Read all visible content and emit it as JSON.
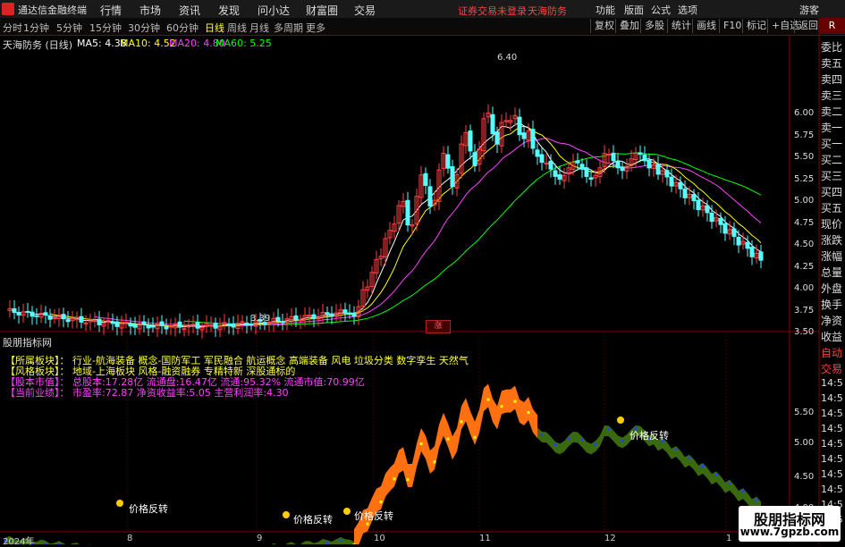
{
  "app": {
    "title": "通达信金融终端",
    "warning": "证券交易未登录",
    "stock_name": "天海防务"
  },
  "menu": [
    "行情",
    "市场",
    "资讯",
    "发现",
    "问小达",
    "财富圈",
    "交易"
  ],
  "right_menu": [
    "功能",
    "版面",
    "公式",
    "选项",
    "游客"
  ],
  "periods": [
    "分时",
    "1分钟",
    "5分钟",
    "15分钟",
    "30分钟",
    "60分钟",
    "日线",
    "周线",
    "月线",
    "多周期",
    "更多"
  ],
  "active_period": "日线",
  "tools": [
    "复权",
    "叠加",
    "多股",
    "统计",
    "画线",
    "F10",
    "标记",
    "+自选",
    "返回"
  ],
  "chart_title": "天海防务 (日线)",
  "ma": {
    "ma5": "MA5: 4.38",
    "ma10": "MA10: 4.52",
    "ma20": "MA20: 4.80",
    "ma60": "MA60: 5.25"
  },
  "colors": {
    "ma5": "#ffffff",
    "ma10": "#ffff00",
    "ma20": "#ff40ff",
    "ma60": "#00ff00",
    "up": "#ff4040",
    "down": "#54ffff"
  },
  "price_axis": [
    "6.00",
    "5.75",
    "5.50",
    "5.25",
    "5.00",
    "4.75",
    "4.50",
    "4.25",
    "4.00",
    "3.75",
    "3.50"
  ],
  "high_label": "6.40",
  "low_label": "3.39",
  "event_tag": "涨",
  "indicator_name": "股朋指标网",
  "indicator_axis": [
    "5.50",
    "5.00",
    "4.50",
    "4.00"
  ],
  "signal_label": "价格反转",
  "info_lines": [
    "【所属板块】：  行业-航海装备 概念-国防军工 军民融合 航运概念 高端装备 风电 垃圾分类 数字孪生 天然气",
    "【风格板块】：  地域-上海板块 风格-融资融券 专精特新 深股通标的",
    "【股本市值】：  总股本:17.28亿 流通盘:16.47亿 流通:95.32% 流通市值:70.99亿",
    "【当前业绩】：  市盈率:72.87 净资收益率:5.05 主营利润率:4.30"
  ],
  "right_panel": [
    "委比",
    "卖五",
    "卖四",
    "卖三",
    "卖二",
    "卖一",
    "买一",
    "买二",
    "买三",
    "买四",
    "买五",
    "现价",
    "涨跌",
    "涨幅",
    "总量",
    "外盘",
    "换手",
    "净资",
    "收益"
  ],
  "trade_panel": [
    "自动",
    "交易"
  ],
  "trade_times": [
    "14:5",
    "14:5",
    "14:5",
    "14:5",
    "14:5",
    "14:5",
    "14:5",
    "14:5",
    "14:5",
    "14:5"
  ],
  "date_axis": [
    "2024年",
    "8",
    "9",
    "10",
    "11",
    "12",
    "1"
  ],
  "watermark": {
    "title": "股朋指标网",
    "url": "www.7gpzb.com"
  }
}
